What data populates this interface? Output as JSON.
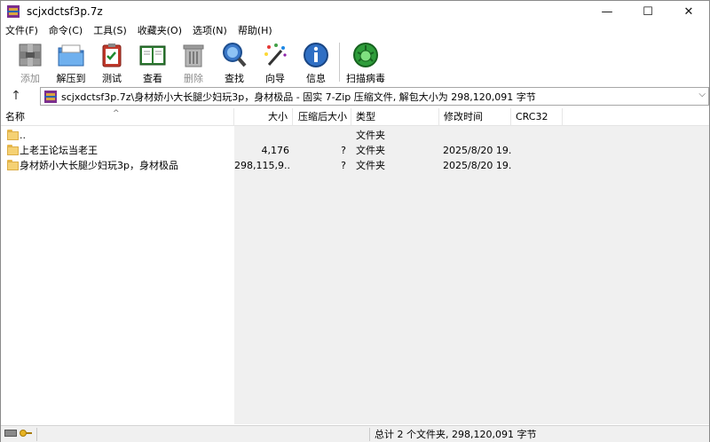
{
  "window": {
    "title": "scjxdctsf3p.7z",
    "minimize": "—",
    "maximize": "☐",
    "close": "✕"
  },
  "menu": [
    "文件(F)",
    "命令(C)",
    "工具(S)",
    "收藏夹(O)",
    "选项(N)",
    "帮助(H)"
  ],
  "toolbar": {
    "add": "添加",
    "extract": "解压到",
    "test": "测试",
    "view": "查看",
    "delete": "删除",
    "find": "查找",
    "wizard": "向导",
    "info": "信息",
    "scan": "扫描病毒"
  },
  "path": {
    "up": "↑",
    "text": "scjxdctsf3p.7z\\身材娇小大长腿少妇玩3p，身材极品 - 固实 7-Zip 压缩文件, 解包大小为 298,120,091 字节",
    "dropdown": "⌵"
  },
  "columns": {
    "name": "名称",
    "size": "大小",
    "packed": "压缩后大小",
    "type": "类型",
    "modified": "修改时间",
    "crc": "CRC32",
    "sort_caret": "^"
  },
  "rows": [
    {
      "name": "..",
      "size": "",
      "packed": "",
      "type": "文件夹",
      "modified": ""
    },
    {
      "name": "上老王论坛当老王",
      "size": "4,176",
      "packed": "?",
      "type": "文件夹",
      "modified": "2025/8/20 19..."
    },
    {
      "name": "身材娇小大长腿少妇玩3p，身材极品",
      "size": "298,115,9...",
      "packed": "?",
      "type": "文件夹",
      "modified": "2025/8/20 19..."
    }
  ],
  "status": {
    "summary": "总计 2 个文件夹, 298,120,091 字节"
  }
}
